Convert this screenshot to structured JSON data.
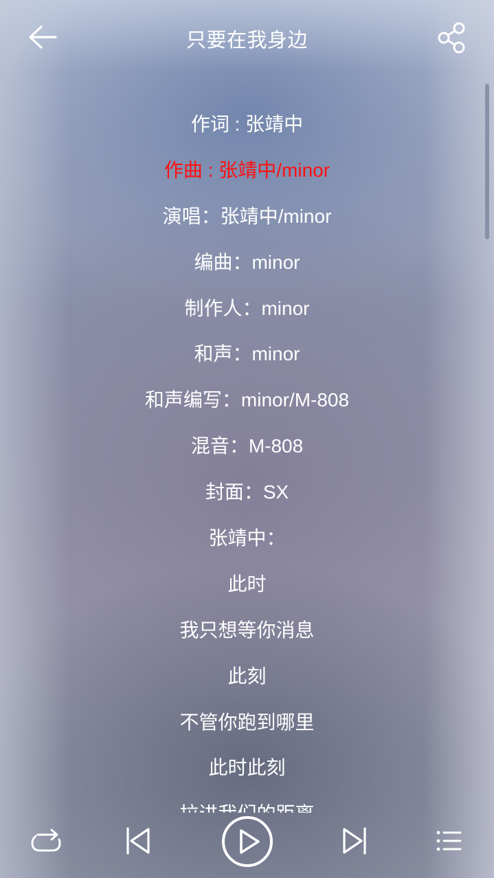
{
  "header": {
    "title": "只要在我身边",
    "back_icon": "arrow-left-icon",
    "share_icon": "share-icon"
  },
  "lyrics": {
    "active_index": 1,
    "active_color": "#ff1010",
    "lines": [
      "作词 : 张靖中",
      "作曲 : 张靖中/minor",
      "演唱：张靖中/minor",
      "编曲：minor",
      "制作人：minor",
      "和声：minor",
      "和声编写：minor/M-808",
      "混音：M-808",
      "封面：SX",
      "张靖中：",
      "此时",
      "我只想等你消息",
      "此刻",
      "不管你跑到哪里",
      "此时此刻",
      "拉进我们的距离"
    ]
  },
  "controls": {
    "loop_icon": "repeat-icon",
    "prev_icon": "skip-previous-icon",
    "play_icon": "play-icon",
    "next_icon": "skip-next-icon",
    "list_icon": "playlist-icon"
  }
}
